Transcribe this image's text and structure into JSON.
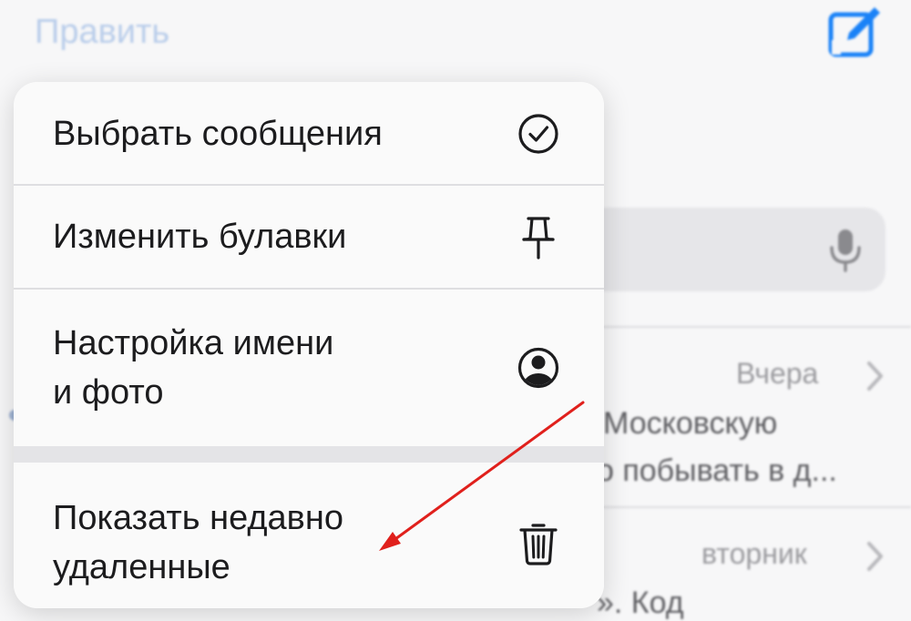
{
  "header": {
    "edit_label": "Править"
  },
  "menu": {
    "items": [
      {
        "label": "Выбрать сообщения",
        "icon": "checkmark-circle-icon"
      },
      {
        "label": "Изменить булавки",
        "icon": "pin-icon"
      },
      {
        "label": "Настройка имени\nи фото",
        "icon": "person-circle-icon"
      },
      {
        "label": "Показать недавно\nудаленные",
        "icon": "trash-icon"
      }
    ]
  },
  "conversations": [
    {
      "date": "Вчера",
      "preview_line1": "Московскую",
      "preview_line2": "о побывать в д..."
    },
    {
      "date": "вторник",
      "preview_line1": "». Код"
    }
  ],
  "colors": {
    "accent": "#1a82f7",
    "annotation_arrow": "#e0201c"
  }
}
